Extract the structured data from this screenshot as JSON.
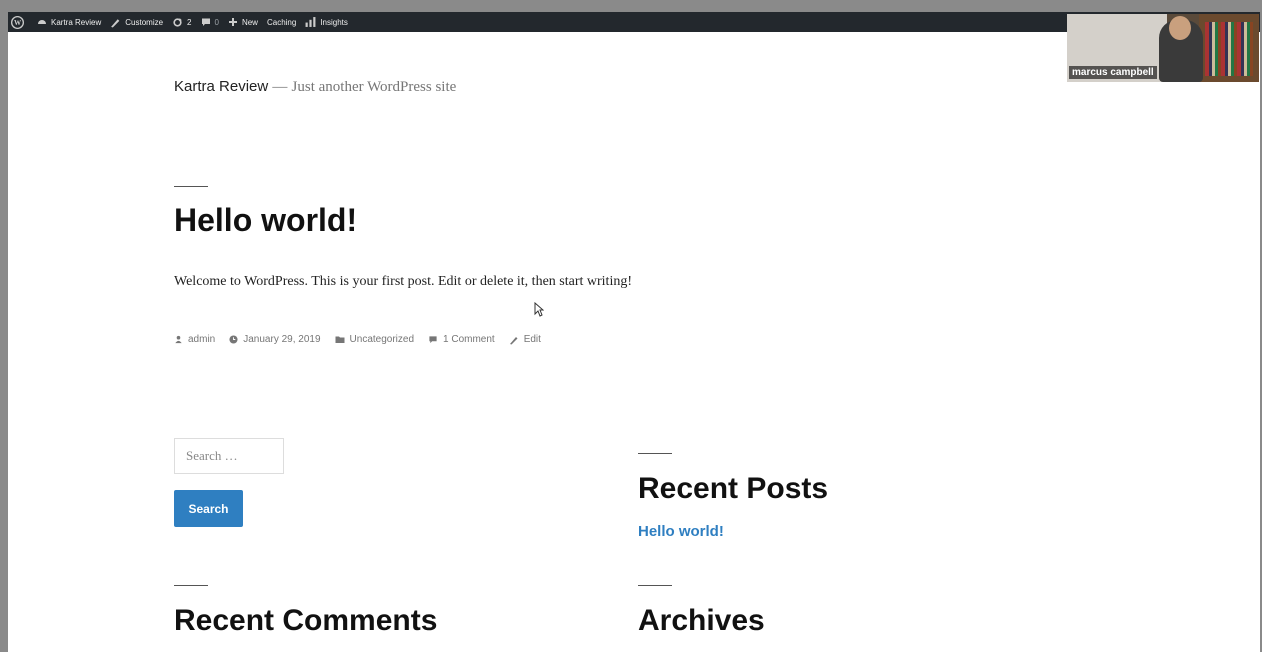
{
  "adminbar": {
    "items": [
      {
        "icon": "wordpress-icon",
        "label": ""
      },
      {
        "icon": "dashboard-icon",
        "label": "Kartra Review"
      },
      {
        "icon": "customize-icon",
        "label": "Customize"
      },
      {
        "icon": "updates-icon",
        "label": "2"
      },
      {
        "icon": "comments-icon",
        "label": "0"
      },
      {
        "icon": "plus-icon",
        "label": "New"
      },
      {
        "icon": "",
        "label": "Caching"
      },
      {
        "icon": "insights-icon",
        "label": "Insights"
      }
    ]
  },
  "video": {
    "name": "marcus campbell"
  },
  "site": {
    "title": "Kartra Review",
    "separator": "—",
    "description": "Just another WordPress site"
  },
  "post": {
    "title": "Hello world!",
    "body": "Welcome to WordPress. This is your first post. Edit or delete it, then start writing!",
    "meta": {
      "author": "admin",
      "date": "January 29, 2019",
      "category": "Uncategorized",
      "comments": "1 Comment",
      "edit": "Edit"
    }
  },
  "search": {
    "placeholder": "Search …",
    "button": "Search"
  },
  "widgets": {
    "recent_posts_title": "Recent Posts",
    "recent_posts": [
      "Hello world!"
    ],
    "recent_comments_title": "Recent Comments",
    "archives_title": "Archives"
  },
  "colors": {
    "adminbar": "#23282d",
    "accent": "#2f7fc1"
  }
}
